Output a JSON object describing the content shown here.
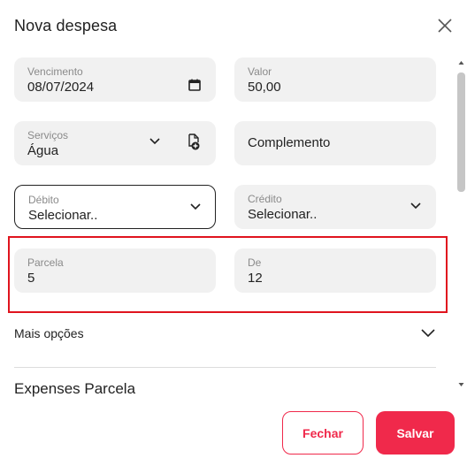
{
  "dialog": {
    "title": "Nova despesa"
  },
  "fields": {
    "vencimento": {
      "label": "Vencimento",
      "value": "08/07/2024"
    },
    "valor": {
      "label": "Valor",
      "value": "50,00"
    },
    "servicos": {
      "label": "Serviços",
      "value": "Água"
    },
    "complemento": {
      "placeholder": "Complemento"
    },
    "debito": {
      "label": "Débito",
      "value": "Selecionar.."
    },
    "credito": {
      "label": "Crédito",
      "value": "Selecionar.."
    },
    "parcela": {
      "label": "Parcela",
      "value": "5"
    },
    "de": {
      "label": "De",
      "value": "12"
    }
  },
  "mais_opcoes": {
    "label": "Mais opções"
  },
  "section": {
    "title": "Expenses Parcela"
  },
  "buttons": {
    "fechar": "Fechar",
    "salvar": "Salvar"
  },
  "colors": {
    "accent": "#f0294b",
    "highlight": "#e0141e",
    "field_bg": "#f1f1f1"
  }
}
